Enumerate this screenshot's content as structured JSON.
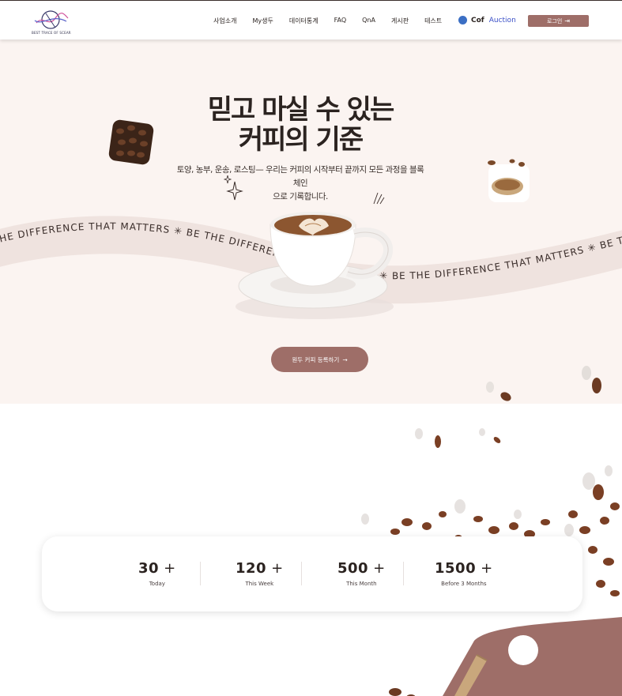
{
  "header": {
    "logo_text": "BEST TRACE OF SCEAR",
    "nav": [
      "사업소개",
      "My생두",
      "데이터통계",
      "FAQ",
      "QnA",
      "게시판",
      "테스트"
    ],
    "brand_cof": "Cof",
    "brand_auction": "Auction",
    "login_label": "로그인",
    "login_icon": "login-arrow-icon"
  },
  "hero": {
    "title_line1": "믿고 마실 수 있는",
    "title_line2": "커피의 기준",
    "subtitle_line1": "토양, 농부, 운송, 로스팅— 우리는 커피의 시작부터 끝까지 모든 과정을 블록체인",
    "subtitle_line2": "으로 기록합니다.",
    "band_text": "BE THE DIFFERENCE THAT MATTERS",
    "cta_label": "원두 커피 등록하기",
    "cta_arrow": "→"
  },
  "stats": [
    {
      "value": "30",
      "label": "Today"
    },
    {
      "value": "120",
      "label": "This Week"
    },
    {
      "value": "500",
      "label": "This Month"
    },
    {
      "value": "1500",
      "label": "Before 3 Months"
    }
  ],
  "stats_plus": "+",
  "colors": {
    "accent": "#9e6e68",
    "hero_bg": "#fbf4f1",
    "band": "#efe3df",
    "auction": "#3a4fc7"
  }
}
